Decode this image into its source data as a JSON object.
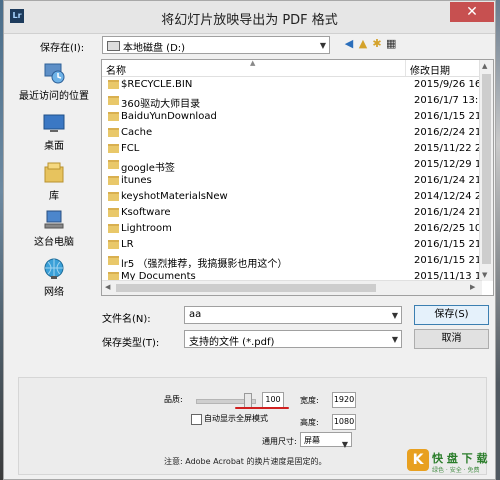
{
  "window": {
    "title": "将幻灯片放映导出为 PDF 格式",
    "app_icon_text": "Lr",
    "close_glyph": "✕"
  },
  "lookin": {
    "label": "保存在(I):",
    "value": "本地磁盘 (D:)"
  },
  "places": [
    {
      "label": "最近访问的位置",
      "icon": "recent-places-icon"
    },
    {
      "label": "桌面",
      "icon": "desktop-icon"
    },
    {
      "label": "库",
      "icon": "libraries-icon"
    },
    {
      "label": "这台电脑",
      "icon": "this-pc-icon"
    },
    {
      "label": "网络",
      "icon": "network-icon"
    }
  ],
  "filelist": {
    "col_name": "名称",
    "col_date": "修改日期",
    "rows": [
      {
        "name": "$RECYCLE.BIN",
        "date": "2015/9/26 16:4"
      },
      {
        "name": "360驱动大师目录",
        "date": "2016/1/7 13:16"
      },
      {
        "name": "BaiduYunDownload",
        "date": "2016/1/15 21:1"
      },
      {
        "name": "Cache",
        "date": "2016/2/24 21:5"
      },
      {
        "name": "FCL",
        "date": "2015/11/22 23"
      },
      {
        "name": "google书签",
        "date": "2015/12/29 12"
      },
      {
        "name": "itunes",
        "date": "2016/1/24 21:5"
      },
      {
        "name": "keyshotMaterialsNew",
        "date": "2014/12/24 21"
      },
      {
        "name": "Ksoftware",
        "date": "2016/1/24 21:4"
      },
      {
        "name": "Lightroom",
        "date": "2016/2/25 10:5"
      },
      {
        "name": "LR",
        "date": "2016/1/15 21:5"
      },
      {
        "name": "lr5 （强烈推荐，我搞摄影也用这个）",
        "date": "2016/1/15 21:3"
      },
      {
        "name": "My Documents",
        "date": "2015/11/13 13"
      }
    ]
  },
  "filename": {
    "label": "文件名(N):",
    "value": "aa"
  },
  "filetype": {
    "label": "保存类型(T):",
    "value": "支持的文件 (*.pdf)"
  },
  "buttons": {
    "save": "保存(S)",
    "cancel": "取消"
  },
  "options": {
    "quality_label": "品质:",
    "quality_value": "100",
    "width_label": "宽度:",
    "width_value": "1920",
    "fullscreen_label": "自动显示全屏模式",
    "height_label": "高度:",
    "height_value": "1080",
    "common_size_label": "通用尺寸:",
    "common_size_value": "屏幕",
    "note": "注意:    Adobe Acrobat 的换片速度是固定的。"
  },
  "watermark": {
    "badge": "K",
    "text": "快 盘 下 载",
    "sub": "绿色 · 安全 · 免费"
  }
}
